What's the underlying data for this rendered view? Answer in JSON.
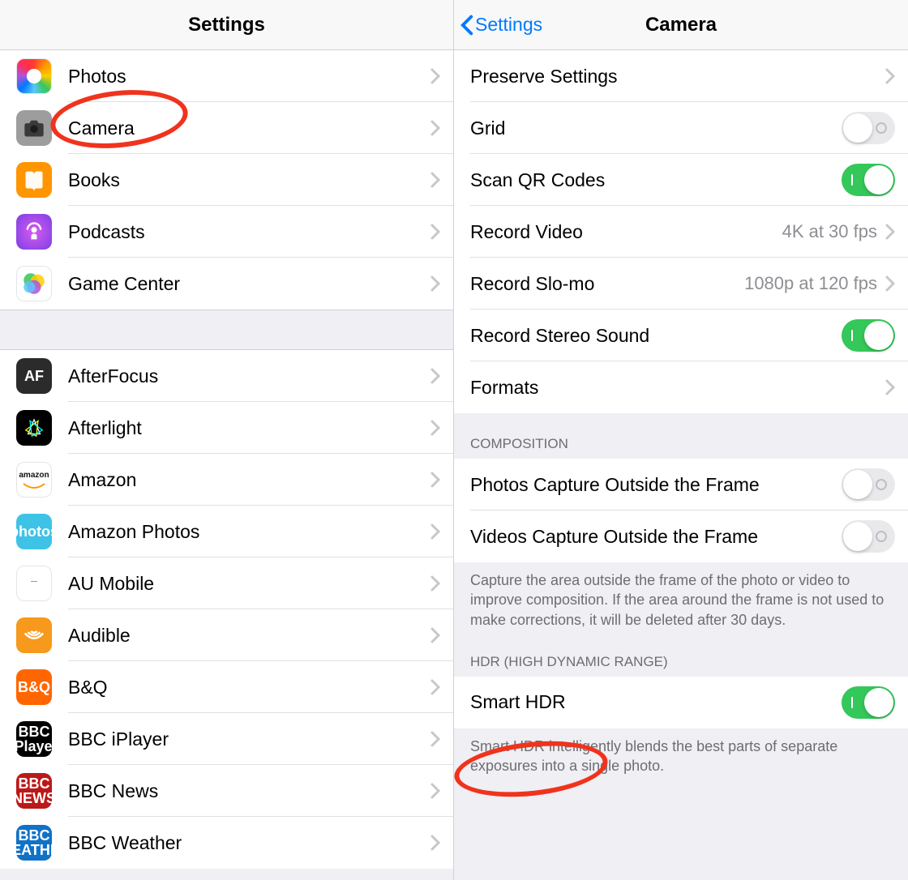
{
  "colors": {
    "link": "#007aff",
    "toggle_on": "#34c759",
    "marker": "#f0331d"
  },
  "left": {
    "title": "Settings",
    "group1": [
      {
        "label": "Photos",
        "icon": "photos"
      },
      {
        "label": "Camera",
        "icon": "camera",
        "marked": true
      },
      {
        "label": "Books",
        "icon": "books"
      },
      {
        "label": "Podcasts",
        "icon": "podcasts"
      },
      {
        "label": "Game Center",
        "icon": "game-center"
      }
    ],
    "group2": [
      {
        "label": "AfterFocus",
        "icon": "afterfocus"
      },
      {
        "label": "Afterlight",
        "icon": "afterlight"
      },
      {
        "label": "Amazon",
        "icon": "amazon"
      },
      {
        "label": "Amazon Photos",
        "icon": "amazon-photos"
      },
      {
        "label": "AU Mobile",
        "icon": "au-mobile"
      },
      {
        "label": "Audible",
        "icon": "audible"
      },
      {
        "label": "B&Q",
        "icon": "bq"
      },
      {
        "label": "BBC iPlayer",
        "icon": "bbc-iplayer"
      },
      {
        "label": "BBC News",
        "icon": "bbc-news"
      },
      {
        "label": "BBC Weather",
        "icon": "bbc-weather"
      }
    ]
  },
  "right": {
    "back": "Settings",
    "title": "Camera",
    "main": {
      "preserve": "Preserve Settings",
      "grid": {
        "label": "Grid",
        "on": false
      },
      "qr": {
        "label": "Scan QR Codes",
        "on": true
      },
      "record_video": {
        "label": "Record Video",
        "value": "4K at 30 fps"
      },
      "record_slomo": {
        "label": "Record Slo-mo",
        "value": "1080p at 120 fps"
      },
      "stereo": {
        "label": "Record Stereo Sound",
        "on": true
      },
      "formats": "Formats"
    },
    "composition": {
      "header": "COMPOSITION",
      "photos_outside": {
        "label": "Photos Capture Outside the Frame",
        "on": false
      },
      "videos_outside": {
        "label": "Videos Capture Outside the Frame",
        "on": false
      },
      "footer": "Capture the area outside the frame of the photo or video to improve composition. If the area around the frame is not used to make corrections, it will be deleted after 30 days."
    },
    "hdr": {
      "header": "HDR (HIGH DYNAMIC RANGE)",
      "smart": {
        "label": "Smart HDR",
        "on": true,
        "marked": true
      },
      "footer": "Smart HDR intelligently blends the best parts of separate exposures into a single photo."
    }
  }
}
